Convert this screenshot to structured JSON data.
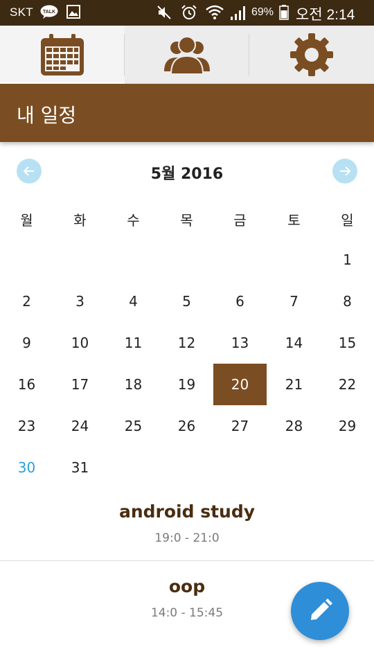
{
  "status_bar": {
    "carrier": "SKT",
    "talk_badge": "TALK",
    "battery_percent": "69%",
    "time": "오전 2:14",
    "icons": [
      "kakaotalk-icon",
      "gallery-icon",
      "mute-icon",
      "alarm-icon",
      "wifi-icon",
      "signal-icon",
      "battery-icon"
    ]
  },
  "tabs": [
    {
      "icon": "calendar-icon",
      "active": true
    },
    {
      "icon": "people-icon",
      "active": false
    },
    {
      "icon": "gear-icon",
      "active": false
    }
  ],
  "header": {
    "title": "내 일정"
  },
  "calendar": {
    "month_label": "5월 2016",
    "prev_icon": "arrow-left-icon",
    "next_icon": "arrow-right-icon",
    "weekdays": [
      "월",
      "화",
      "수",
      "목",
      "금",
      "토",
      "일"
    ],
    "weeks": [
      [
        "",
        "",
        "",
        "",
        "",
        "",
        "1"
      ],
      [
        "2",
        "3",
        "4",
        "5",
        "6",
        "7",
        "8"
      ],
      [
        "9",
        "10",
        "11",
        "12",
        "13",
        "14",
        "15"
      ],
      [
        "16",
        "17",
        "18",
        "19",
        "20",
        "21",
        "22"
      ],
      [
        "23",
        "24",
        "25",
        "26",
        "27",
        "28",
        "29"
      ],
      [
        "30",
        "31",
        "",
        "",
        "",
        "",
        ""
      ]
    ],
    "selected_day": "20",
    "highlighted_day": "30"
  },
  "events": [
    {
      "title": "android study",
      "time": "19:0 - 21:0"
    },
    {
      "title": "oop",
      "time": "14:0 - 15:45"
    }
  ],
  "fab": {
    "icon": "pencil-icon"
  },
  "colors": {
    "status_bar": "#3d2a12",
    "primary_brown": "#7b4d22",
    "accent_blue": "#2e8ed8",
    "nav_button_blue": "#b7e1f3",
    "today_blue": "#2aa0d8",
    "event_title": "#4a2d10"
  }
}
